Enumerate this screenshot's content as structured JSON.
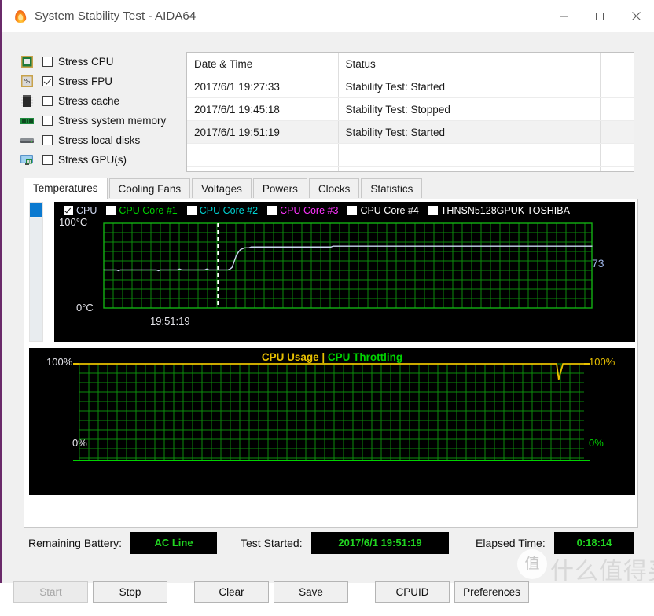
{
  "window": {
    "title": "System Stability Test - AIDA64",
    "icon": "flame-icon",
    "minimize_label": "─",
    "maximize_label": "☐",
    "close_label": "✕"
  },
  "stress_options": [
    {
      "label": "Stress CPU",
      "checked": false,
      "icon": "cpu-chip-icon"
    },
    {
      "label": "Stress FPU",
      "checked": true,
      "icon": "fpu-chip-icon"
    },
    {
      "label": "Stress cache",
      "checked": false,
      "icon": "cache-chip-icon"
    },
    {
      "label": "Stress system memory",
      "checked": false,
      "icon": "memory-module-icon"
    },
    {
      "label": "Stress local disks",
      "checked": false,
      "icon": "hard-disk-icon"
    },
    {
      "label": "Stress GPU(s)",
      "checked": false,
      "icon": "gpu-monitor-icon"
    }
  ],
  "log": {
    "columns": [
      "Date & Time",
      "Status",
      ""
    ],
    "rows": [
      {
        "datetime": "2017/6/1 19:27:33",
        "status": "Stability Test: Started",
        "selected": false
      },
      {
        "datetime": "2017/6/1 19:45:18",
        "status": "Stability Test: Stopped",
        "selected": false
      },
      {
        "datetime": "2017/6/1 19:51:19",
        "status": "Stability Test: Started",
        "selected": true
      },
      {
        "datetime": "",
        "status": "",
        "selected": false
      },
      {
        "datetime": "",
        "status": "",
        "selected": false
      }
    ]
  },
  "tabs": [
    {
      "label": "Temperatures",
      "active": true
    },
    {
      "label": "Cooling Fans",
      "active": false
    },
    {
      "label": "Voltages",
      "active": false
    },
    {
      "label": "Powers",
      "active": false
    },
    {
      "label": "Clocks",
      "active": false
    },
    {
      "label": "Statistics",
      "active": false
    }
  ],
  "temperature_legend": [
    {
      "label": "CPU",
      "checked": true,
      "color": "#cfd8f0"
    },
    {
      "label": "CPU Core #1",
      "checked": false,
      "color": "#00d200"
    },
    {
      "label": "CPU Core #2",
      "checked": false,
      "color": "#00d2d2"
    },
    {
      "label": "CPU Core #3",
      "checked": false,
      "color": "#ff33ff"
    },
    {
      "label": "CPU Core #4",
      "checked": false,
      "color": "#ffffff"
    },
    {
      "label": "THNSN5128GPUK TOSHIBA",
      "checked": false,
      "color": "#ffffff"
    }
  ],
  "usage_title": {
    "cpu_usage": "CPU Usage",
    "separator": "|",
    "cpu_throttling": "CPU Throttling",
    "usage_color": "#e8c000",
    "throttling_color": "#00d200"
  },
  "status": {
    "battery_label": "Remaining Battery:",
    "battery_value": "AC Line",
    "started_label": "Test Started:",
    "started_value": "2017/6/1 19:51:19",
    "elapsed_label": "Elapsed Time:",
    "elapsed_value": "0:18:14"
  },
  "buttons": [
    {
      "label": "Start",
      "disabled": true
    },
    {
      "label": "Stop",
      "disabled": false
    },
    {
      "label": "Clear",
      "disabled": false
    },
    {
      "label": "Save",
      "disabled": false
    },
    {
      "label": "CPUID",
      "disabled": false
    },
    {
      "label": "Preferences",
      "disabled": false
    }
  ],
  "watermark": {
    "mark": "值",
    "text": "什么值得买"
  },
  "chart_data": [
    {
      "type": "line",
      "title": "Temperatures",
      "ylabel_top": "100°C",
      "ylabel_bottom": "0°C",
      "xlabel": "19:51:19",
      "ylim": [
        0,
        100
      ],
      "grid": true,
      "marker_time": "19:51:19",
      "marker_x_ratio": 0.234,
      "current_value_label": "73",
      "series": [
        {
          "name": "CPU",
          "color": "#c9d6ee",
          "unit": "°C",
          "values": [
            45,
            45,
            45,
            45,
            45,
            45,
            45,
            44,
            45,
            45,
            45,
            45,
            45,
            45,
            45,
            45,
            45,
            45,
            45,
            45,
            45,
            45,
            45,
            45,
            45,
            45,
            44,
            45,
            45,
            45,
            45,
            45,
            45,
            45,
            45,
            45,
            46,
            45,
            45,
            45,
            45,
            45,
            45,
            45,
            45,
            45,
            45,
            45,
            45,
            46,
            45,
            45,
            45,
            45,
            45,
            45,
            45,
            45,
            45,
            45,
            46,
            48,
            55,
            62,
            66,
            69,
            70,
            71,
            71,
            71,
            72,
            72,
            72,
            72,
            72,
            72,
            72,
            72,
            72,
            72,
            72,
            72,
            72,
            72,
            72,
            72,
            72,
            72,
            72,
            72,
            72,
            72,
            72,
            72,
            72,
            72,
            72,
            72,
            72,
            72,
            72,
            72,
            72,
            72,
            72,
            72,
            72,
            72,
            72,
            73,
            73,
            73,
            73,
            73,
            73,
            73,
            73,
            73,
            73,
            73,
            73,
            73,
            73,
            73,
            73,
            73,
            73,
            73,
            73,
            73,
            73,
            73,
            73,
            73,
            73,
            73,
            73,
            73,
            73,
            73,
            73,
            73,
            73,
            73,
            73,
            73,
            73,
            73,
            73,
            73,
            73,
            73,
            73,
            73,
            73,
            73,
            73,
            73,
            73,
            73,
            73,
            73,
            73,
            73,
            73,
            73,
            73,
            73,
            73,
            73,
            73,
            73,
            73,
            73,
            73,
            73,
            73,
            73,
            73,
            73,
            73,
            73,
            73,
            73,
            73,
            73,
            73,
            73,
            73,
            73,
            73,
            73,
            73,
            73,
            73,
            73,
            73,
            73,
            73,
            73,
            73,
            73,
            73,
            73,
            73,
            73,
            73,
            73,
            73,
            73,
            73,
            73,
            73,
            73,
            73,
            73,
            73,
            73,
            73,
            73,
            73,
            73,
            73,
            73,
            73,
            73,
            73,
            73,
            73,
            73,
            73,
            73,
            73
          ]
        }
      ]
    },
    {
      "type": "line",
      "title": "CPU Usage | CPU Throttling",
      "ylabel_top_left": "100%",
      "ylabel_bottom_left": "0%",
      "ylabel_top_right": "100%",
      "ylabel_bottom_right": "0%",
      "ylim": [
        0,
        100
      ],
      "grid": true,
      "series": [
        {
          "name": "CPU Usage",
          "color": "#e8c000",
          "unit": "%",
          "values": [
            100,
            100,
            100,
            100,
            100,
            100,
            100,
            100,
            100,
            100,
            100,
            100,
            100,
            100,
            100,
            100,
            100,
            100,
            100,
            100,
            100,
            100,
            100,
            100,
            100,
            100,
            100,
            100,
            100,
            100,
            100,
            100,
            100,
            100,
            100,
            100,
            100,
            100,
            100,
            100,
            100,
            100,
            100,
            100,
            100,
            100,
            100,
            100,
            100,
            100,
            100,
            100,
            100,
            100,
            100,
            100,
            100,
            100,
            100,
            100,
            100,
            100,
            100,
            100,
            100,
            100,
            100,
            100,
            100,
            100,
            100,
            100,
            100,
            100,
            100,
            100,
            100,
            100,
            100,
            100,
            100,
            100,
            100,
            100,
            100,
            100,
            100,
            100,
            100,
            100,
            100,
            100,
            100,
            100,
            100,
            100,
            100,
            100,
            100,
            100,
            100,
            100,
            100,
            100,
            100,
            100,
            100,
            100,
            100,
            100,
            100,
            100,
            100,
            100,
            100,
            100,
            100,
            100,
            100,
            100,
            100,
            100,
            100,
            100,
            100,
            100,
            100,
            100,
            100,
            100,
            100,
            100,
            100,
            100,
            100,
            100,
            100,
            100,
            100,
            100,
            100,
            100,
            100,
            100,
            100,
            100,
            100,
            100,
            100,
            100,
            100,
            100,
            100,
            100,
            100,
            100,
            100,
            100,
            100,
            100,
            100,
            100,
            100,
            100,
            100,
            100,
            100,
            100,
            100,
            100,
            100,
            100,
            100,
            100,
            100,
            100,
            100,
            100,
            100,
            100,
            100,
            100,
            100,
            100,
            100,
            100,
            100,
            100,
            100,
            100,
            100,
            100,
            100,
            100,
            100,
            100,
            100,
            100,
            100,
            100,
            100,
            100,
            100,
            100,
            100,
            100,
            100,
            100,
            100,
            100,
            100,
            100,
            100,
            100,
            100,
            100,
            100,
            100,
            100,
            100,
            100,
            100,
            100,
            100,
            100,
            100,
            100,
            84,
            92,
            100,
            100,
            100,
            100,
            100,
            100,
            100,
            100,
            100,
            100,
            100
          ]
        },
        {
          "name": "CPU Throttling",
          "color": "#00d200",
          "unit": "%",
          "values": [
            0,
            0,
            0,
            0,
            0,
            0,
            0,
            0,
            0,
            0,
            0,
            0,
            0,
            0,
            0,
            0,
            0,
            0,
            0,
            0,
            0,
            0,
            0,
            0,
            0,
            0,
            0,
            0,
            0,
            0,
            0,
            0,
            0,
            0,
            0,
            0,
            0,
            0,
            0,
            0,
            0,
            0,
            0,
            0,
            0,
            0,
            0,
            0,
            0,
            0,
            0,
            0,
            0,
            0,
            0,
            0,
            0,
            0,
            0,
            0,
            0,
            0,
            0,
            0,
            0,
            0,
            0,
            0,
            0,
            0,
            0,
            0,
            0,
            0,
            0,
            0,
            0,
            0,
            0,
            0,
            0,
            0,
            0,
            0,
            0,
            0,
            0,
            0,
            0,
            0,
            0,
            0,
            0,
            0,
            0,
            0,
            0,
            0,
            0,
            0,
            0,
            0,
            0,
            0,
            0,
            0,
            0,
            0,
            0,
            0,
            0,
            0,
            0,
            0,
            0,
            0,
            0,
            0,
            0,
            0,
            0,
            0,
            0,
            0,
            0,
            0,
            0,
            0,
            0,
            0,
            0,
            0,
            0,
            0,
            0,
            0,
            0,
            0,
            0,
            0,
            0,
            0,
            0,
            0,
            0,
            0,
            0,
            0,
            0,
            0,
            0,
            0,
            0,
            0,
            0,
            0,
            0,
            0,
            0,
            0,
            0,
            0,
            0,
            0,
            0,
            0,
            0,
            0,
            0,
            0,
            0,
            0,
            0,
            0,
            0,
            0,
            0,
            0,
            0,
            0,
            0,
            0,
            0,
            0,
            0,
            0,
            0,
            0,
            0,
            0,
            0,
            0,
            0,
            0,
            0,
            0,
            0,
            0,
            0,
            0,
            0,
            0,
            0,
            0,
            0,
            0,
            0,
            0,
            0,
            0,
            0,
            0,
            0,
            0,
            0,
            0,
            0,
            0,
            0,
            0,
            0,
            0,
            0,
            0,
            0,
            0,
            0,
            0,
            0,
            0,
            0,
            0,
            0,
            0,
            0,
            0,
            0,
            0,
            0,
            0
          ]
        }
      ]
    }
  ]
}
